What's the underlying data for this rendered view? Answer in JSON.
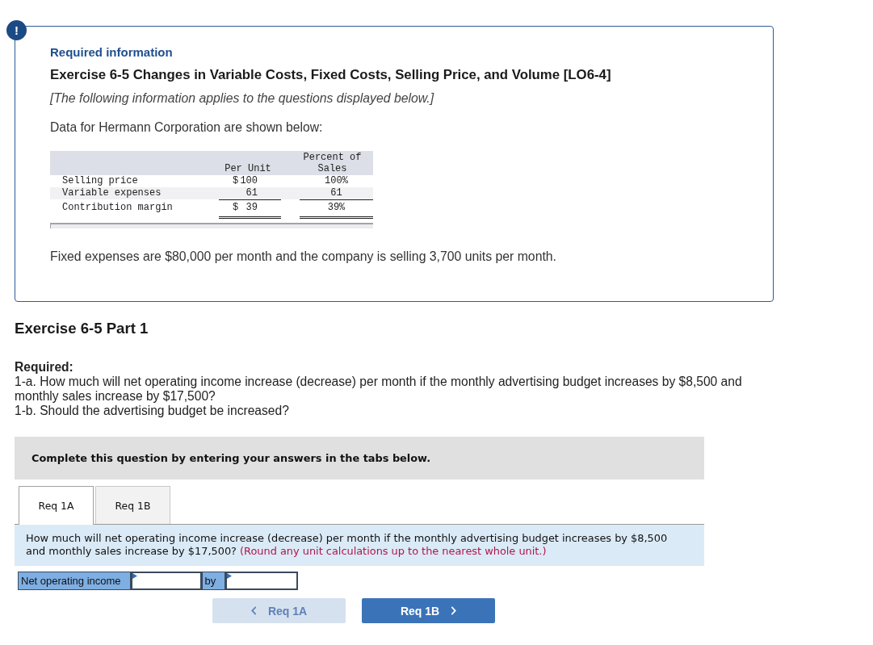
{
  "alert_badge": {
    "symbol": "!"
  },
  "info_box": {
    "heading": "Required information",
    "title": "Exercise 6-5 Changes in Variable Costs, Fixed Costs, Selling Price, and Volume [LO6-4]",
    "note": "[The following information applies to the questions displayed below.]",
    "intro": "Data for Hermann Corporation are shown below:",
    "table": {
      "columns": [
        "Per Unit",
        "Percent of Sales"
      ],
      "rows": [
        {
          "label": "Selling price",
          "kind": "item",
          "cells": [
            {
              "prefix": "$",
              "value": "100"
            },
            {
              "value": "100%"
            }
          ]
        },
        {
          "label": "Variable expenses",
          "kind": "subtotal",
          "cells": [
            {
              "value": "61"
            },
            {
              "value": "61"
            }
          ]
        },
        {
          "label": "Contribution margin",
          "kind": "total",
          "cells": [
            {
              "prefix": "$",
              "value": "39"
            },
            {
              "value": "39%"
            }
          ]
        }
      ]
    },
    "footnote": "Fixed expenses are $80,000 per month and the company is selling 3,700 units per month."
  },
  "part_title": "Exercise 6-5 Part 1",
  "required": {
    "heading": "Required:",
    "items": [
      "1-a. How much will net operating income increase (decrease) per month if the monthly advertising budget increases by $8,500 and monthly sales increase by $17,500?",
      "1-b. Should the advertising budget be increased?"
    ]
  },
  "instruction_bar": "Complete this question by entering your answers in the tabs below.",
  "tabs": [
    {
      "label": "Req 1A",
      "selected": true
    },
    {
      "label": "Req 1B",
      "selected": false
    }
  ],
  "question": {
    "text": "How much will net operating income increase (decrease) per month if the monthly advertising budget increases by $8,500 and monthly sales increase by $17,500?",
    "hint": "(Round any unit calculations up to the nearest whole unit.)"
  },
  "answer_row": [
    {
      "kind": "label",
      "text": "Net operating income"
    },
    {
      "kind": "input"
    },
    {
      "kind": "label",
      "text": "by"
    },
    {
      "kind": "input"
    }
  ],
  "nav_buttons": [
    {
      "label": "Req 1A",
      "kind": "back",
      "disabled": true
    },
    {
      "label": "Req 1B",
      "kind": "forward",
      "disabled": false
    }
  ]
}
